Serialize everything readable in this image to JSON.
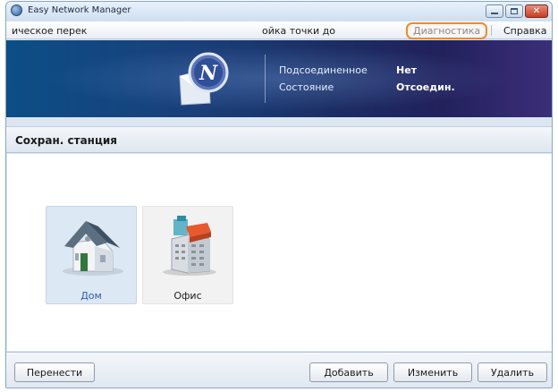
{
  "window": {
    "title": "Easy Network Manager"
  },
  "menu": {
    "items": [
      {
        "label": "ическое перек"
      },
      {
        "label": "ойка точки до"
      },
      {
        "label": "Диагностика"
      },
      {
        "label": "Справка"
      }
    ],
    "highlight_color": "#f08a2c"
  },
  "banner": {
    "connected_label": "Подсоединенное",
    "connected_value": "Нет",
    "state_label": "Состояние",
    "state_value": "Отсоедин."
  },
  "section": {
    "title": "Сохран. станция"
  },
  "stations": [
    {
      "label": "Дом",
      "icon": "house-icon",
      "selected": true
    },
    {
      "label": "Офис",
      "icon": "office-building-icon",
      "selected": false
    }
  ],
  "buttons": {
    "move": "Перенести",
    "add": "Добавить",
    "edit": "Изменить",
    "delete": "Удалить"
  },
  "colors": {
    "banner_start": "#0c4e86",
    "banner_end": "#3c2e7a",
    "selected_tile": "#dde8f5",
    "selected_label": "#2b5fa8"
  }
}
